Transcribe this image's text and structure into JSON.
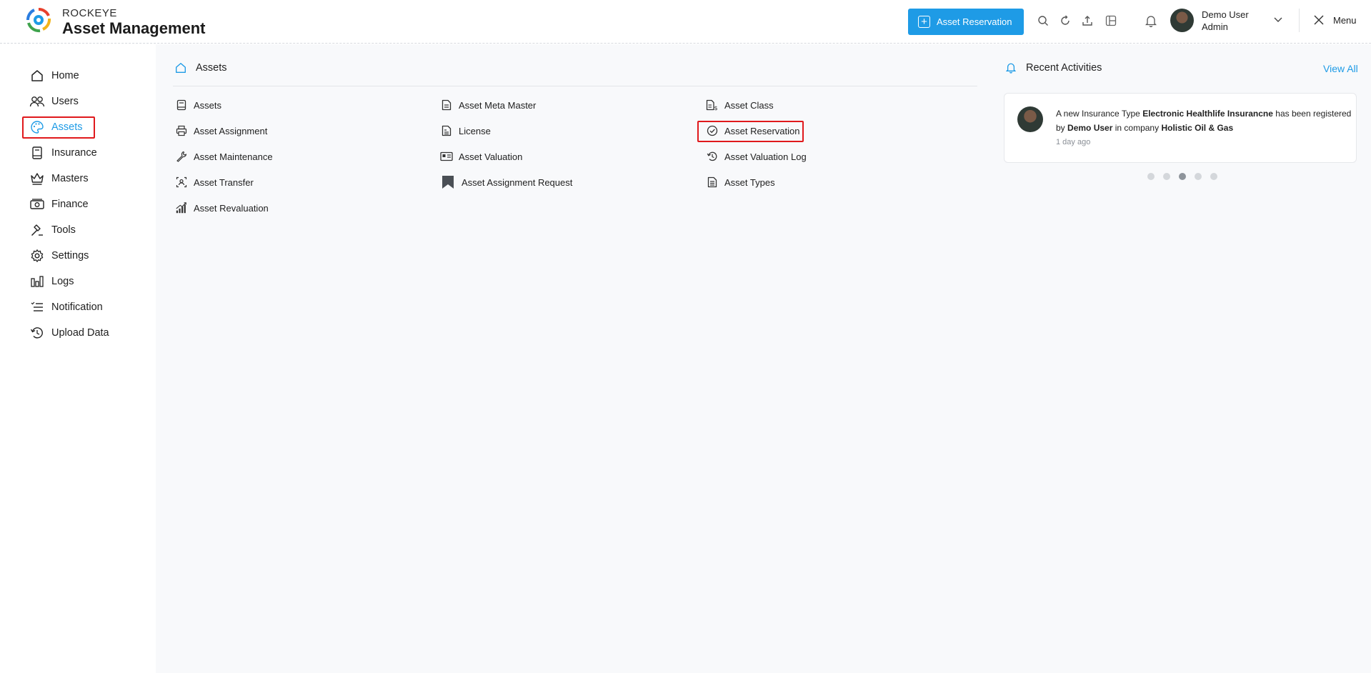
{
  "header": {
    "brand_top": "ROCKEYE",
    "brand_main": "Asset Management",
    "reserve_button": "Asset Reservation",
    "user_name": "Demo User",
    "user_role": "Admin",
    "menu_label": "Menu"
  },
  "sidebar": {
    "items": [
      {
        "label": "Home",
        "icon": "home-icon"
      },
      {
        "label": "Users",
        "icon": "users-icon"
      },
      {
        "label": "Assets",
        "icon": "palette-icon"
      },
      {
        "label": "Insurance",
        "icon": "book-icon"
      },
      {
        "label": "Masters",
        "icon": "crown-icon"
      },
      {
        "label": "Finance",
        "icon": "money-icon"
      },
      {
        "label": "Tools",
        "icon": "hammer-icon"
      },
      {
        "label": "Settings",
        "icon": "gear-icon"
      },
      {
        "label": "Logs",
        "icon": "bar-chart-icon"
      },
      {
        "label": "Notification",
        "icon": "list-check-icon"
      },
      {
        "label": "Upload Data",
        "icon": "history-icon"
      }
    ],
    "active": "Assets"
  },
  "main": {
    "section_title": "Assets",
    "links": [
      {
        "label": "Assets",
        "icon": "document-icon"
      },
      {
        "label": "Asset Meta Master",
        "icon": "file-text-icon"
      },
      {
        "label": "Asset Class",
        "icon": "file-dollar-icon"
      },
      {
        "label": "Asset Assignment",
        "icon": "printer-icon"
      },
      {
        "label": "License",
        "icon": "file-lines-icon"
      },
      {
        "label": "Asset Reservation",
        "icon": "check-circle-icon"
      },
      {
        "label": "Asset Maintenance",
        "icon": "wrench-icon"
      },
      {
        "label": "Asset Valuation",
        "icon": "id-card-icon"
      },
      {
        "label": "Asset Valuation Log",
        "icon": "history-icon"
      },
      {
        "label": "Asset Transfer",
        "icon": "transfer-icon"
      },
      {
        "label": "Asset Assignment Request",
        "icon": "bookmark-icon"
      },
      {
        "label": "Asset Types",
        "icon": "file-list-icon"
      },
      {
        "label": "Asset Revaluation",
        "icon": "growth-chart-icon"
      }
    ]
  },
  "activities": {
    "title": "Recent Activities",
    "view_all": "View All",
    "item": {
      "prefix": "A new Insurance Type",
      "subject": "Electronic Healthlife Insurancne",
      "middle": "has been registered by",
      "actor": "Demo User",
      "company_prefix": "in company",
      "company": "Holistic Oil & Gas",
      "time": "1 day ago"
    },
    "pager_active_index": 2,
    "pager_count": 5
  },
  "colors": {
    "accent": "#1e9be6",
    "highlight": "#e0191c",
    "background": "#f8f9fb"
  }
}
